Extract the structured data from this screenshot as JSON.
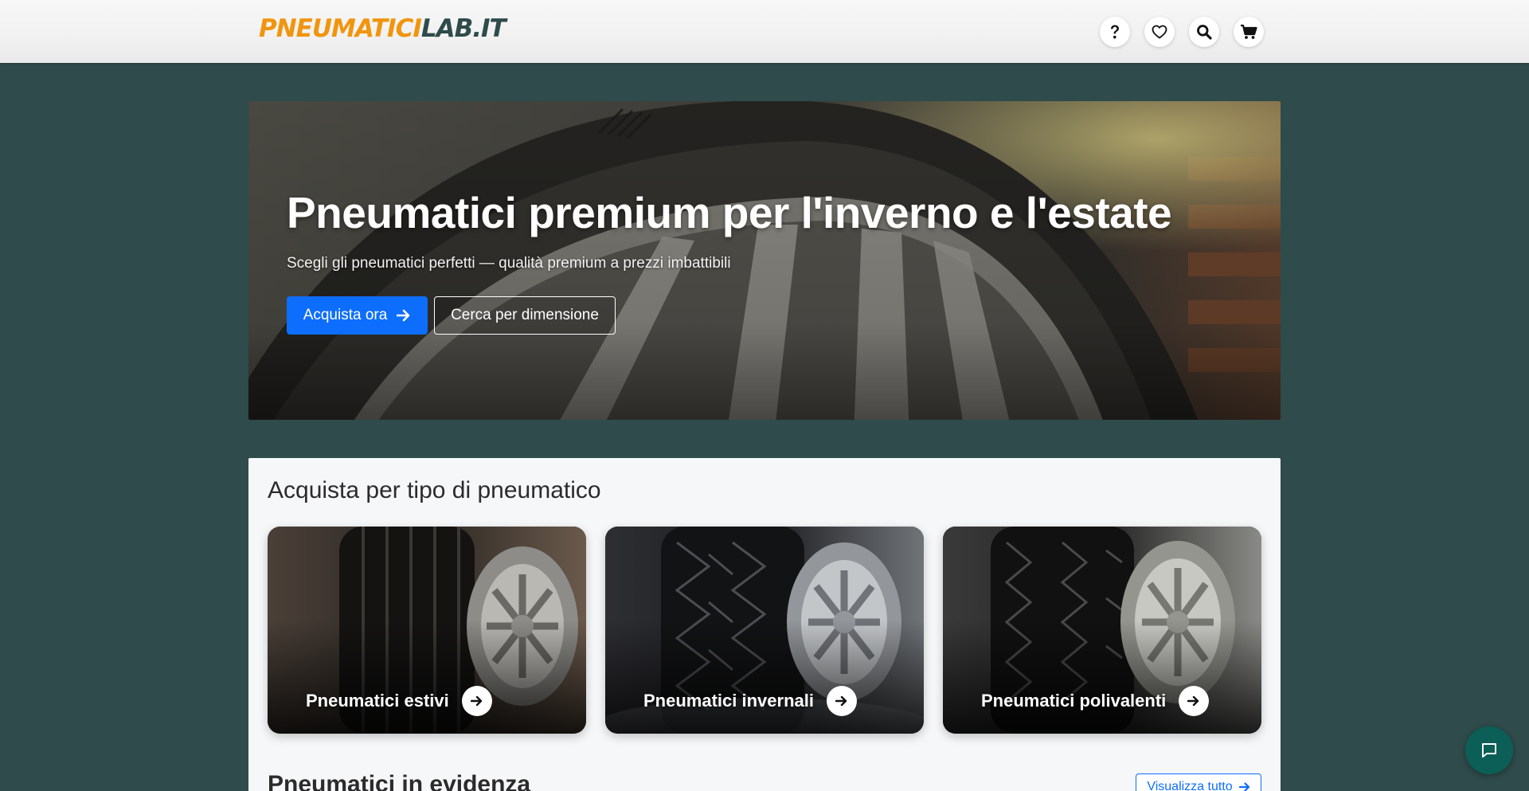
{
  "header": {
    "logo_part1": "PNEUMATICI",
    "logo_part2": "LAB.IT",
    "icons": [
      "help-icon",
      "heart-icon",
      "search-icon",
      "cart-icon"
    ]
  },
  "hero": {
    "title": "Pneumatici premium per l'inverno e l'estate",
    "subtitle": "Scegli gli pneumatici perfetti — qualità premium a prezzi imbattibili",
    "primary_button": "Acquista ora",
    "secondary_button": "Cerca per dimensione"
  },
  "categories": {
    "title": "Acquista per tipo di pneumatico",
    "items": [
      {
        "label": "Pneumatici estivi"
      },
      {
        "label": "Pneumatici invernali"
      },
      {
        "label": "Pneumatici polivalenti"
      }
    ]
  },
  "featured": {
    "title": "Pneumatici in evidenza",
    "view_all": "Visualizza tutto"
  },
  "colors": {
    "page_bg": "#2f4b4b",
    "brand_orange": "#f0950f",
    "brand_dark": "#2f4b4b",
    "primary": "#0d6efd",
    "chat": "#0b5f57"
  }
}
